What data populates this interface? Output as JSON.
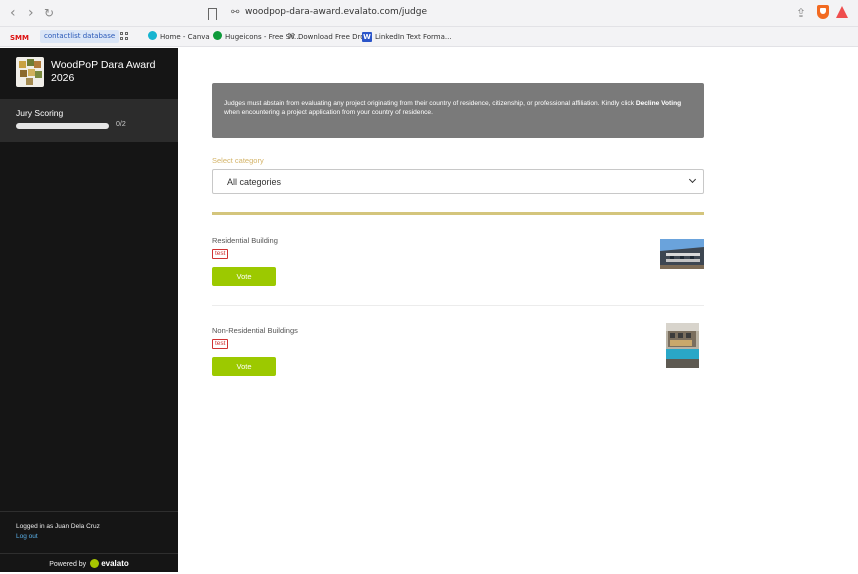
{
  "browser": {
    "url": "woodpop-dara-award.evalato.com/judge",
    "bookmarks": [
      {
        "label": "SMM"
      },
      {
        "label": "contactlist database"
      },
      {
        "label": "Home - Canva"
      },
      {
        "label": "Hugeicons - Free SV..."
      },
      {
        "label": "Download Free Dro..."
      },
      {
        "label": "LinkedIn Text Forma..."
      }
    ]
  },
  "sidebar": {
    "award_title": "WoodPoP Dara Award 2026",
    "jury_label": "Jury Scoring",
    "progress_text": "0/2",
    "progress_fraction": 0.0,
    "logged_in_text": "Logged in as Juan Dela Cruz",
    "logout_label": "Log out",
    "powered_by": "Powered by",
    "brand": "evalato"
  },
  "main": {
    "notice_text": "Judges must abstain from evaluating any project originating from their country of residence, citizenship, or professional affiliation. Kindly click ",
    "notice_bold": "Decline Voting",
    "notice_tail": " when encountering a project application from your country of residence.",
    "category_label": "Select category",
    "category_value": "All categories",
    "entries": [
      {
        "title": "Residential Building",
        "badge": "test",
        "vote_label": "Vote"
      },
      {
        "title": "Non-Residential Buildings",
        "badge": "test",
        "vote_label": "Vote"
      }
    ]
  },
  "colors": {
    "sidebar_bg": "#151515",
    "accent_green": "#9cc900",
    "gold": "#d4c57c",
    "notice_bg": "#7a7a7a"
  }
}
